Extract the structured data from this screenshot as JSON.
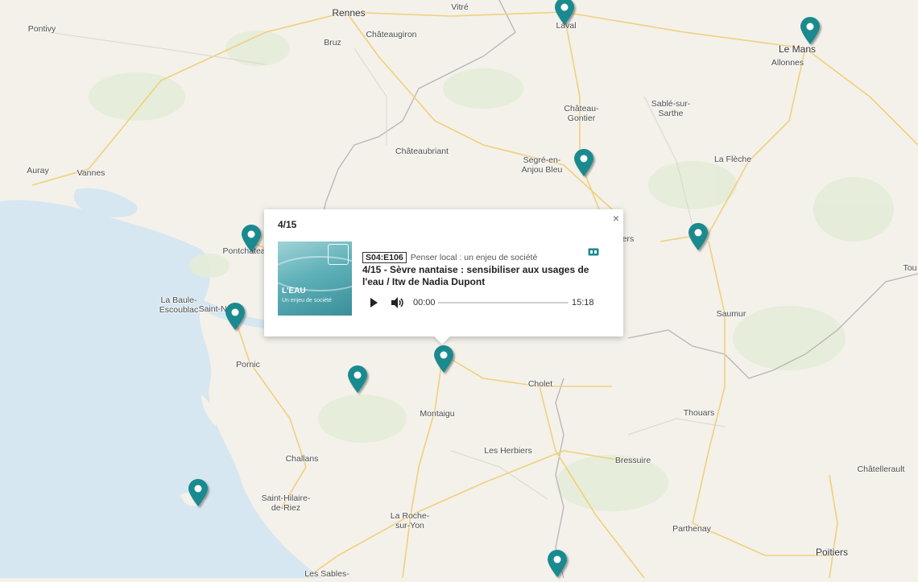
{
  "map": {
    "cities": [
      {
        "name": "Rennes",
        "big": true
      },
      {
        "name": "Vitré"
      },
      {
        "name": "Laval"
      },
      {
        "name": "Le Mans",
        "big": true
      },
      {
        "name": "Allonnes"
      },
      {
        "name": "Pontivy"
      },
      {
        "name": "Bruz"
      },
      {
        "name": "Châteaugiron"
      },
      {
        "name": "Château-\nGontier"
      },
      {
        "name": "Sablé-sur-\nSarthe"
      },
      {
        "name": "Châteaubriant"
      },
      {
        "name": "Segré-en-\nAnjou Bleu"
      },
      {
        "name": "La Flèche"
      },
      {
        "name": "Auray"
      },
      {
        "name": "Vannes"
      },
      {
        "name": "Pontchâteau"
      },
      {
        "name": "La Baule-\nEscoublac"
      },
      {
        "name": "Saint-Na"
      },
      {
        "name": "ers"
      },
      {
        "name": "Saumur"
      },
      {
        "name": "Tou"
      },
      {
        "name": "Pornic"
      },
      {
        "name": "Cholet"
      },
      {
        "name": "Montaigu"
      },
      {
        "name": "Thouars"
      },
      {
        "name": "Les Herbiers"
      },
      {
        "name": "Challans"
      },
      {
        "name": "Bressuire"
      },
      {
        "name": "Châtellerault"
      },
      {
        "name": "Saint-Hilaire-\nde-Riez"
      },
      {
        "name": "La Roche-\nsur-Yon"
      },
      {
        "name": "Parthenay"
      },
      {
        "name": "Poitiers",
        "big": true
      },
      {
        "name": "Les Sables-"
      }
    ],
    "marker_color": "#1a8a8f"
  },
  "popup": {
    "counter": "4/15",
    "close_label": "×",
    "image_title": "L'EAU",
    "image_subtitle": "Un enjeu de société",
    "episode_code": "S04:E106",
    "series_name": "Penser local : un enjeu de société",
    "tag_icon": "ticket-icon",
    "title": "4/15 - Sèvre nantaise : sensibiliser aux usages de l'eau / Itw de Nadia Dupont",
    "player": {
      "current_time": "00:00",
      "duration": "15:18",
      "progress": 0
    }
  }
}
